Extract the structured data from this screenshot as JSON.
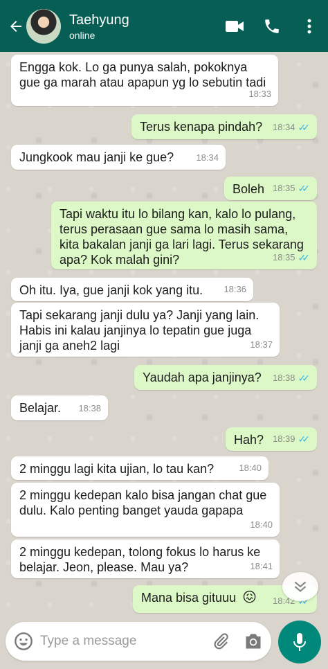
{
  "header": {
    "contact_name": "Taehyung",
    "status": "online"
  },
  "messages": [
    {
      "dir": "in",
      "text": "Engga kok. Lo ga punya salah, pokoknya gue ga marah atau apapun yg lo sebutin tadi",
      "time": "18:33"
    },
    {
      "dir": "out",
      "text": "Terus kenapa pindah?",
      "time": "18:34"
    },
    {
      "dir": "in",
      "text": "Jungkook mau janji ke gue?",
      "time": "18:34"
    },
    {
      "dir": "out",
      "text": "Boleh",
      "time": "18:35"
    },
    {
      "dir": "out",
      "text": "Tapi waktu itu lo bilang kan, kalo lo pulang, terus perasaan gue sama lo masih sama, kita bakalan janji ga lari lagi. Terus sekarang apa? Kok malah gini?",
      "time": "18:35"
    },
    {
      "dir": "in",
      "text": "Oh itu. Iya, gue janji kok yang itu.",
      "time": "18:36"
    },
    {
      "dir": "in",
      "text": "Tapi sekarang janji dulu ya? Janji yang lain. Habis ini kalau janjinya lo tepatin gue juga janji ga aneh2 lagi",
      "time": "18:37"
    },
    {
      "dir": "out",
      "text": "Yaudah apa janjinya?",
      "time": "18:38"
    },
    {
      "dir": "in",
      "text": "Belajar.",
      "time": "18:38"
    },
    {
      "dir": "out",
      "text": "Hah?",
      "time": "18:39"
    },
    {
      "dir": "in",
      "text": "2 minggu lagi kita ujian, lo tau kan?",
      "time": "18:40"
    },
    {
      "dir": "in",
      "text": "2 minggu kedepan kalo bisa jangan chat gue dulu. Kalo penting banget yauda gapapa",
      "time": "18:40"
    },
    {
      "dir": "in",
      "text": "2 minggu kedepan, tolong fokus lo harus ke belajar. Jeon, please. Mau ya?",
      "time": "18:41"
    },
    {
      "dir": "out",
      "text": "Mana bisa gituuu",
      "emoji": "😖",
      "time": "18:42"
    }
  ],
  "composer": {
    "placeholder": "Type a message"
  },
  "colors": {
    "header": "#075e54",
    "outgoing_bubble": "#dcf8c6",
    "incoming_bubble": "#ffffff",
    "read_ticks": "#34b7f1",
    "send_button": "#00897b"
  },
  "icons": [
    "back-arrow-icon",
    "video-call-icon",
    "phone-icon",
    "more-vert-icon",
    "emoji-icon",
    "attach-icon",
    "camera-icon",
    "mic-icon",
    "chevron-down-icon"
  ]
}
